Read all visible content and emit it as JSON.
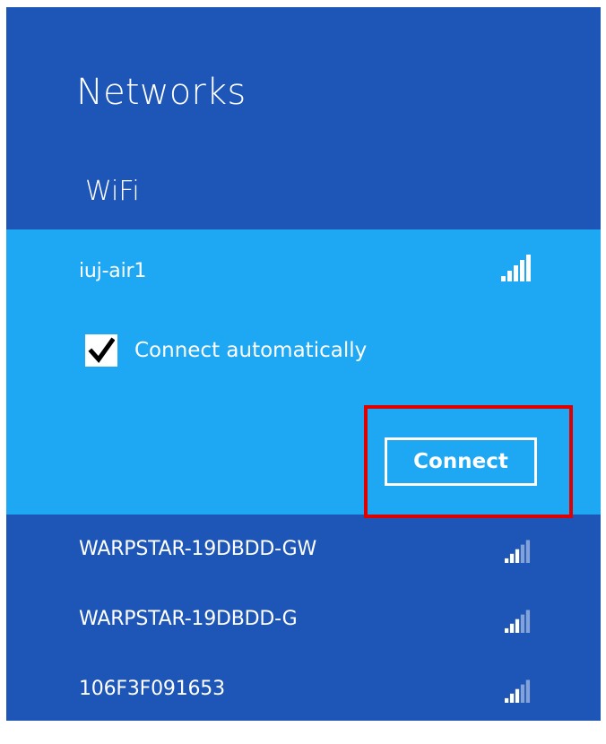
{
  "panel": {
    "title": "Networks",
    "section_label": "WiFi",
    "background_color": "#1e56b8",
    "selected_color": "#1ea8f3",
    "highlight_color": "#e00000"
  },
  "selected_network": {
    "name": "iuj-air1",
    "signal_icon": "signal-strength-icon",
    "signal_bars": 5,
    "auto_connect_label": "Connect automatically",
    "auto_connect_checked": true,
    "connect_label": "Connect"
  },
  "networks": [
    {
      "name": "WARPSTAR-19DBDD-GW",
      "signal_bars": 3,
      "signal_icon": "signal-strength-icon"
    },
    {
      "name": "WARPSTAR-19DBDD-G",
      "signal_bars": 3,
      "signal_icon": "signal-strength-icon"
    },
    {
      "name": "106F3F091653",
      "signal_bars": 3,
      "signal_icon": "signal-strength-icon"
    }
  ]
}
